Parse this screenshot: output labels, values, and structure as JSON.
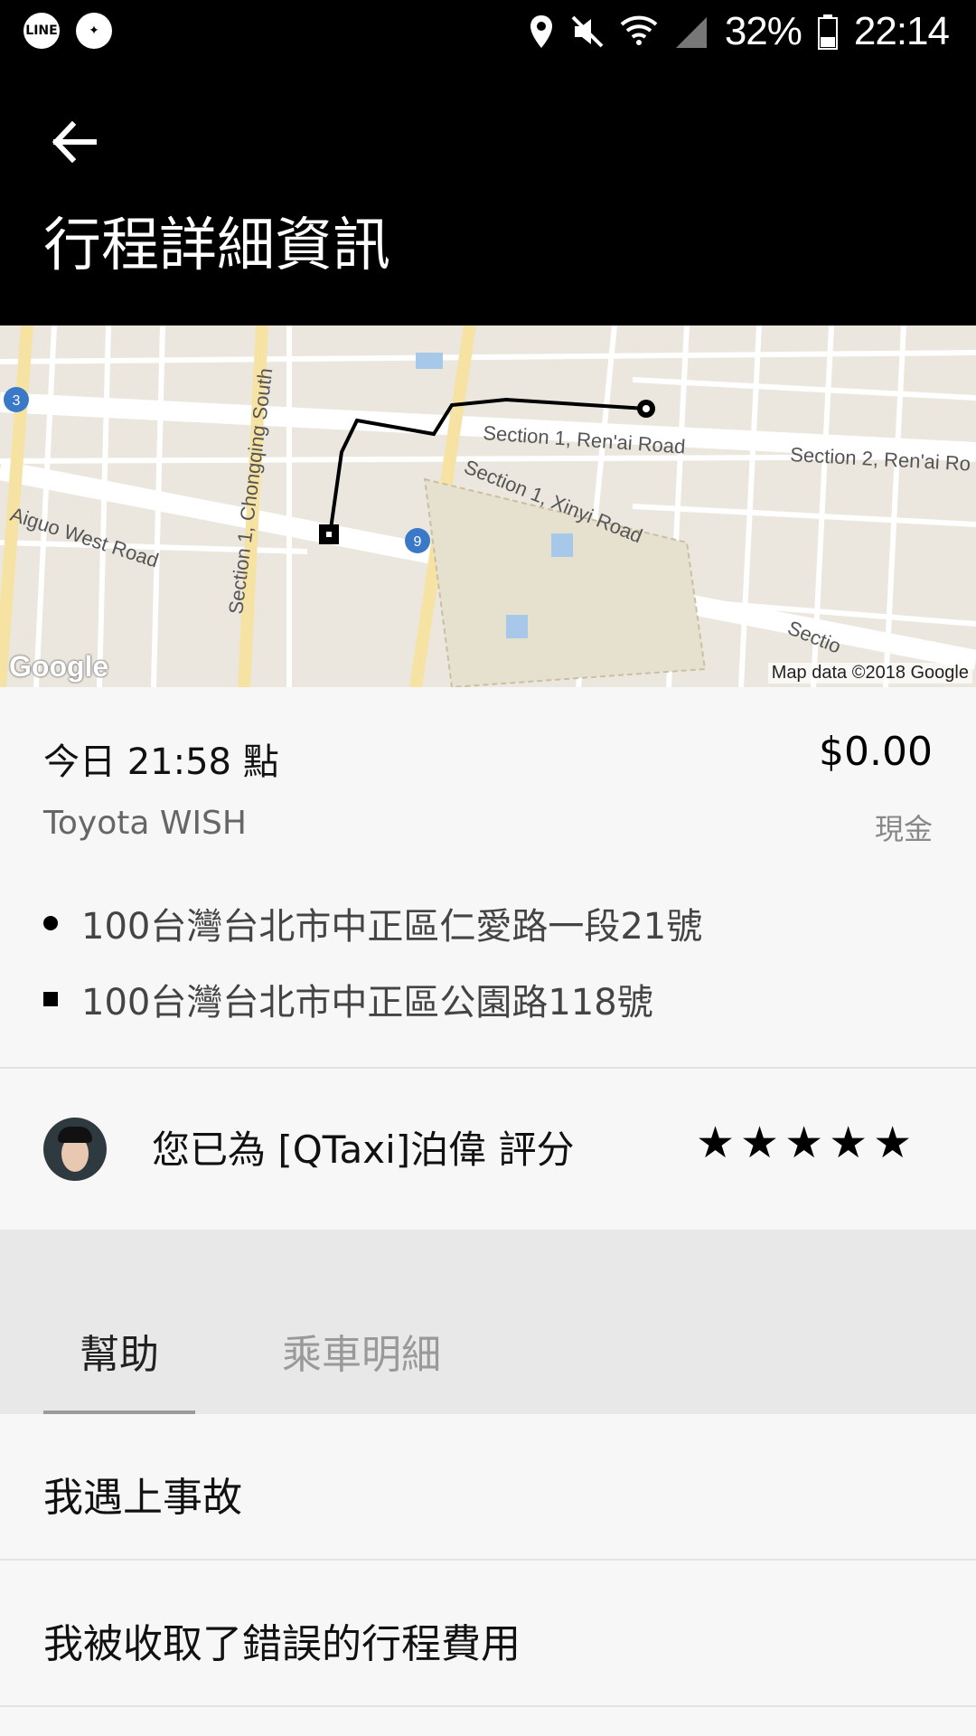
{
  "status_bar": {
    "battery": "32%",
    "time": "22:14",
    "left_icons": [
      "line-icon",
      "game-icon"
    ],
    "right_icons": [
      "location-icon",
      "mute-icon",
      "wifi-icon",
      "signal-icon",
      "battery-icon"
    ]
  },
  "header": {
    "title": "行程詳細資訊",
    "back_icon": "arrow-left-icon"
  },
  "map": {
    "streets": [
      "Section 1, Ren'ai Road",
      "Section 2, Ren'ai Ro",
      "Section 1, Xinyi Road",
      "Section 1, Chongqing South",
      "Aiguo West Road",
      "Sectio"
    ],
    "route_badges": [
      "3",
      "9"
    ],
    "logo": "Google",
    "credit": "Map data ©2018 Google"
  },
  "trip": {
    "datetime": "今日 21:58 點",
    "price": "$0.00",
    "vehicle": "Toyota WISH",
    "payment": "現金",
    "pickup": "100台灣台北市中正區仁愛路一段21號",
    "dropoff": "100台灣台北市中正區公園路118號"
  },
  "rating": {
    "text": "您已為 [QTaxi]泊偉 評分",
    "stars": "★★★★★",
    "value": 5
  },
  "tabs": {
    "help": "幫助",
    "ride_detail": "乘車明細"
  },
  "help_items": [
    "我遇上事故",
    "我被收取了錯誤的行程費用"
  ]
}
